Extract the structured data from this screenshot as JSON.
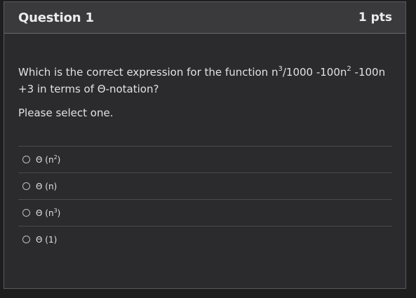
{
  "header": {
    "title": "Question 1",
    "points": "1 pts"
  },
  "question": {
    "text_part1": "Which is the correct expression for the function n",
    "sup1": "3",
    "text_part2": "/1000 -100n",
    "sup2": "2",
    "text_part3": " -100n +3 in terms of Θ-notation?",
    "instruction": "Please select one."
  },
  "answers": [
    {
      "symbol": "Θ",
      "pre": " (n",
      "sup": "2",
      "post": ")"
    },
    {
      "symbol": "Θ",
      "pre": " (n)",
      "sup": "",
      "post": ""
    },
    {
      "symbol": "Θ",
      "pre": " (n",
      "sup": "3",
      "post": ")"
    },
    {
      "symbol": "Θ",
      "pre": " (1)",
      "sup": "",
      "post": ""
    }
  ]
}
